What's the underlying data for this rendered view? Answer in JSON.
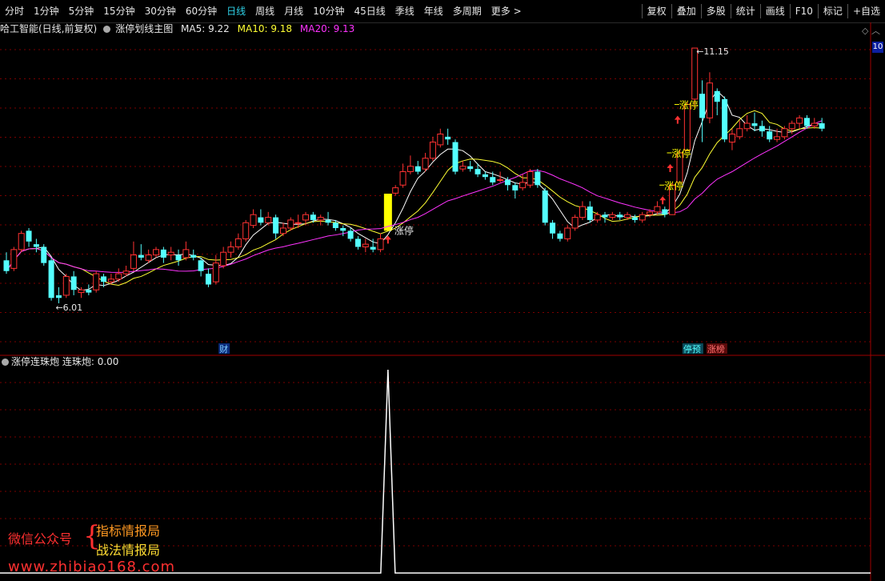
{
  "toolbar": {
    "periods": [
      "分时",
      "1分钟",
      "5分钟",
      "15分钟",
      "30分钟",
      "60分钟",
      "日线",
      "周线",
      "月线",
      "10分钟",
      "45日线",
      "季线",
      "年线",
      "多周期",
      "更多 >"
    ],
    "active_index": 6,
    "buttons": [
      "复权",
      "叠加",
      "多股",
      "统计",
      "画线",
      "F10",
      "标记",
      "+自选"
    ]
  },
  "info_bar": {
    "stock": "哈工智能(日线,前复权)",
    "indicator_name": "涨停划线主图",
    "ma5": "MA5: 9.22",
    "ma10": "MA10: 9.18",
    "ma20": "MA20: 9.13"
  },
  "right_price_tag": "10",
  "labels": {
    "high": "11.15",
    "low": "6.01",
    "limit_up": "涨停",
    "cai": "财",
    "tingyu": "停预",
    "zhangbang": "涨榜"
  },
  "sub_bar": {
    "name": "涨停连珠炮",
    "value": "连珠炮: 0.00"
  },
  "watermark": {
    "label": "微信公众号",
    "line1": "指标情报局",
    "line2": "战法情报局",
    "url": "www.zhibiao168.com"
  },
  "colors": {
    "up": "#ff3232",
    "down": "#54ffff",
    "ma5": "#ffffff",
    "ma10": "#ffff33",
    "ma20": "#ff33ff",
    "highlight": "#ffff00"
  },
  "chart_data": {
    "type": "candlestick",
    "price_range": [
      5.7,
      11.3
    ],
    "candles": [
      [
        7.2,
        7.0,
        7.35,
        6.95
      ],
      [
        7.05,
        7.4,
        7.45,
        7.0
      ],
      [
        7.4,
        7.7,
        7.75,
        7.35
      ],
      [
        7.75,
        7.55,
        7.8,
        7.45
      ],
      [
        7.5,
        7.45,
        7.6,
        7.35
      ],
      [
        7.45,
        7.15,
        7.5,
        7.1
      ],
      [
        7.2,
        6.5,
        7.25,
        6.45
      ],
      [
        6.55,
        6.5,
        6.7,
        6.4
      ],
      [
        6.55,
        6.9,
        6.95,
        6.5
      ],
      [
        6.9,
        6.65,
        7.0,
        6.55
      ],
      [
        6.6,
        6.65,
        6.7,
        6.5
      ],
      [
        6.65,
        6.6,
        6.75,
        6.55
      ],
      [
        6.65,
        6.95,
        7.0,
        6.6
      ],
      [
        6.9,
        6.8,
        6.95,
        6.7
      ],
      [
        6.8,
        6.85,
        6.95,
        6.75
      ],
      [
        6.85,
        6.95,
        7.05,
        6.8
      ],
      [
        6.95,
        7.0,
        7.1,
        6.9
      ],
      [
        7.05,
        7.3,
        7.55,
        7.0
      ],
      [
        7.3,
        7.25,
        7.5,
        7.2
      ],
      [
        7.2,
        7.3,
        7.4,
        7.15
      ],
      [
        7.3,
        7.4,
        7.45,
        7.25
      ],
      [
        7.4,
        7.25,
        7.45,
        7.15
      ],
      [
        7.3,
        7.35,
        7.45,
        7.2
      ],
      [
        7.3,
        7.2,
        7.4,
        7.1
      ],
      [
        7.25,
        7.4,
        7.55,
        7.2
      ],
      [
        7.3,
        7.25,
        7.4,
        7.2
      ],
      [
        7.2,
        7.0,
        7.25,
        6.9
      ],
      [
        6.95,
        6.75,
        7.05,
        6.7
      ],
      [
        6.8,
        7.15,
        7.3,
        6.75
      ],
      [
        7.1,
        7.35,
        7.45,
        7.05
      ],
      [
        7.35,
        7.45,
        7.55,
        7.25
      ],
      [
        7.45,
        7.6,
        7.7,
        7.4
      ],
      [
        7.6,
        7.9,
        7.95,
        7.55
      ],
      [
        7.85,
        8.05,
        8.15,
        7.8
      ],
      [
        8.0,
        7.9,
        8.15,
        7.85
      ],
      [
        7.9,
        8.0,
        8.1,
        7.85
      ],
      [
        8.0,
        7.7,
        8.05,
        7.6
      ],
      [
        7.7,
        7.8,
        7.9,
        7.65
      ],
      [
        7.8,
        7.95,
        8.0,
        7.75
      ],
      [
        7.9,
        7.9,
        8.05,
        7.8
      ],
      [
        7.95,
        8.05,
        8.1,
        7.85
      ],
      [
        8.05,
        7.95,
        8.1,
        7.9
      ],
      [
        7.95,
        8.0,
        8.05,
        7.85
      ],
      [
        7.95,
        7.9,
        8.1,
        7.85
      ],
      [
        7.9,
        7.8,
        7.95,
        7.75
      ],
      [
        7.8,
        7.75,
        7.85,
        7.65
      ],
      [
        7.75,
        7.6,
        7.8,
        7.55
      ],
      [
        7.6,
        7.45,
        7.65,
        7.4
      ],
      [
        7.45,
        7.5,
        7.6,
        7.35
      ],
      [
        7.45,
        7.4,
        7.6,
        7.35
      ],
      [
        7.4,
        7.6,
        7.7,
        7.35
      ],
      [
        7.75,
        8.44,
        8.5,
        7.75
      ],
      [
        8.45,
        8.55,
        8.6,
        8.4
      ],
      [
        8.6,
        8.85,
        9.0,
        8.55
      ],
      [
        8.85,
        8.95,
        9.15,
        8.8
      ],
      [
        8.95,
        8.85,
        9.05,
        8.8
      ],
      [
        8.9,
        9.1,
        9.2,
        8.85
      ],
      [
        9.1,
        9.4,
        9.5,
        9.05
      ],
      [
        9.35,
        9.55,
        9.65,
        9.3
      ],
      [
        9.5,
        9.45,
        9.65,
        9.35
      ],
      [
        9.4,
        8.85,
        9.45,
        8.8
      ],
      [
        8.9,
        8.95,
        9.05,
        8.85
      ],
      [
        8.95,
        8.9,
        9.05,
        8.85
      ],
      [
        8.9,
        8.8,
        9.0,
        8.75
      ],
      [
        8.8,
        8.75,
        8.85,
        8.7
      ],
      [
        8.75,
        8.65,
        8.85,
        8.6
      ],
      [
        8.7,
        8.7,
        8.85,
        8.65
      ],
      [
        8.7,
        8.6,
        8.75,
        8.5
      ],
      [
        8.6,
        8.5,
        8.65,
        8.35
      ],
      [
        8.55,
        8.65,
        8.8,
        8.5
      ],
      [
        8.6,
        8.85,
        8.9,
        8.55
      ],
      [
        8.85,
        8.6,
        8.9,
        8.55
      ],
      [
        8.5,
        7.9,
        8.55,
        7.85
      ],
      [
        7.9,
        7.7,
        7.95,
        7.6
      ],
      [
        7.7,
        7.6,
        7.75,
        7.55
      ],
      [
        7.6,
        7.8,
        7.85,
        7.55
      ],
      [
        7.8,
        8.0,
        8.05,
        7.75
      ],
      [
        8.0,
        8.2,
        8.3,
        7.95
      ],
      [
        8.2,
        7.95,
        8.3,
        7.9
      ],
      [
        7.95,
        8.05,
        8.1,
        7.9
      ],
      [
        8.05,
        8.0,
        8.1,
        7.9
      ],
      [
        8.0,
        8.05,
        8.1,
        7.95
      ],
      [
        8.05,
        8.0,
        8.1,
        7.95
      ],
      [
        8.0,
        8.05,
        8.1,
        7.95
      ],
      [
        8.0,
        7.95,
        8.05,
        7.9
      ],
      [
        7.95,
        8.05,
        8.1,
        7.9
      ],
      [
        8.05,
        8.1,
        8.15,
        8.0
      ],
      [
        8.1,
        8.2,
        8.3,
        8.05
      ],
      [
        8.15,
        8.05,
        8.2,
        8.0
      ],
      [
        8.05,
        8.6,
        8.65,
        8.05
      ],
      [
        8.65,
        9.2,
        9.25,
        8.65
      ],
      [
        9.25,
        10.1,
        10.15,
        9.25
      ],
      [
        10.2,
        11.15,
        11.15,
        10.05
      ],
      [
        10.3,
        9.85,
        10.55,
        9.4
      ],
      [
        9.85,
        10.5,
        10.7,
        9.75
      ],
      [
        10.35,
        10.15,
        10.4,
        9.9
      ],
      [
        10.2,
        9.45,
        10.25,
        9.4
      ],
      [
        9.4,
        9.55,
        9.65,
        9.25
      ],
      [
        9.5,
        9.65,
        9.8,
        9.45
      ],
      [
        9.65,
        9.75,
        9.9,
        9.6
      ],
      [
        9.75,
        9.7,
        9.95,
        9.6
      ],
      [
        9.7,
        9.6,
        9.8,
        9.5
      ],
      [
        9.6,
        9.45,
        9.7,
        9.4
      ],
      [
        9.45,
        9.5,
        9.65,
        9.4
      ],
      [
        9.5,
        9.65,
        9.7,
        9.45
      ],
      [
        9.65,
        9.75,
        9.8,
        9.55
      ],
      [
        9.75,
        9.85,
        9.9,
        9.65
      ],
      [
        9.85,
        9.7,
        9.9,
        9.65
      ],
      [
        9.7,
        9.75,
        9.85,
        9.65
      ],
      [
        9.75,
        9.65,
        9.85,
        9.6
      ]
    ],
    "limit_up_days": [
      51,
      89,
      90,
      91
    ],
    "sub_series": {
      "name": "连珠炮",
      "peak_index": 51,
      "peak_value": 1
    }
  }
}
